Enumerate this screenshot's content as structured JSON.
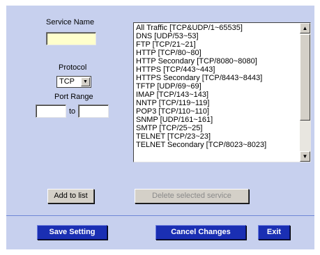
{
  "labels": {
    "service_name": "Service Name",
    "protocol": "Protocol",
    "port_range": "Port Range",
    "to": "to"
  },
  "fields": {
    "service_name_value": "",
    "port_start_value": "",
    "port_end_value": ""
  },
  "protocol": {
    "selected": "TCP"
  },
  "services": [
    "All Traffic [TCP&UDP/1~65535]",
    "DNS [UDP/53~53]",
    "FTP [TCP/21~21]",
    "HTTP [TCP/80~80]",
    "HTTP Secondary [TCP/8080~8080]",
    "HTTPS [TCP/443~443]",
    "HTTPS Secondary [TCP/8443~8443]",
    "TFTP [UDP/69~69]",
    "IMAP [TCP/143~143]",
    "NNTP [TCP/119~119]",
    "POP3 [TCP/110~110]",
    "SNMP [UDP/161~161]",
    "SMTP [TCP/25~25]",
    "TELNET [TCP/23~23]",
    "TELNET Secondary [TCP/8023~8023]"
  ],
  "buttons": {
    "add_to_list": "Add to list",
    "delete_selected": "Delete selected service",
    "save_setting": "Save Setting",
    "cancel_changes": "Cancel Changes",
    "exit": "Exit"
  },
  "icons": {
    "dropdown": "chevron-down-icon",
    "scroll_up": "arrow-up-icon",
    "scroll_down": "arrow-down-icon"
  },
  "colors": {
    "panel_bg": "#c7d0ee",
    "primary_button": "#1a2fb3",
    "input_highlight": "#ffffcc"
  }
}
